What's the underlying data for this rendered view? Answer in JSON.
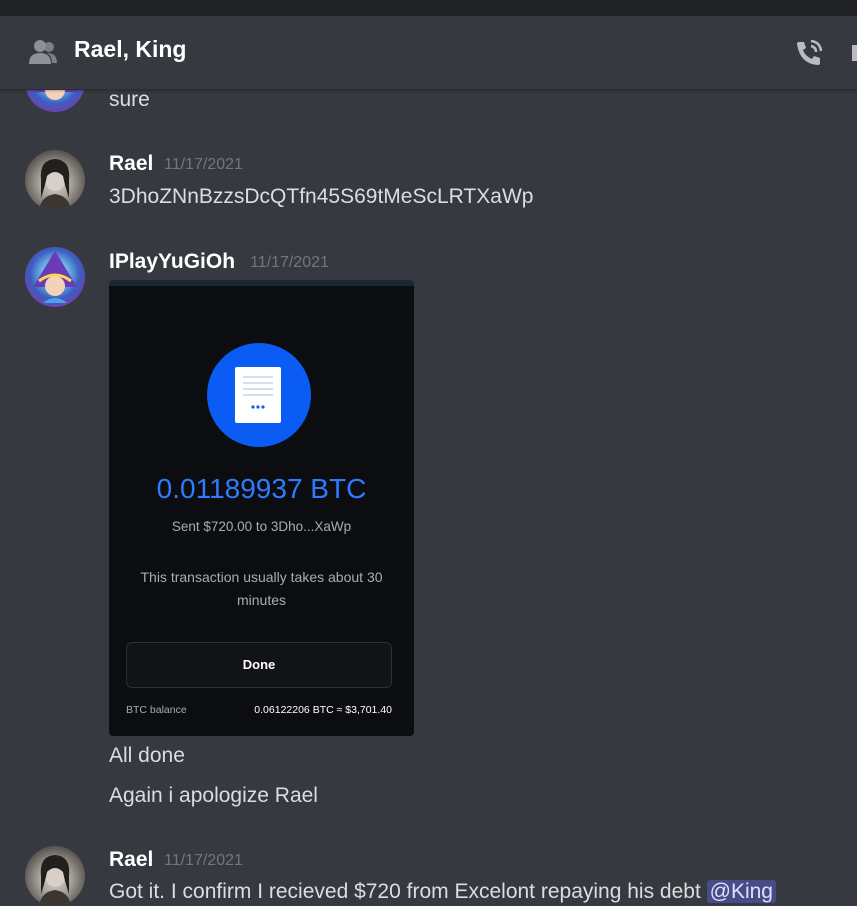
{
  "header": {
    "title": "Rael, King",
    "group_icon": "group-dm-icon",
    "call_icon": "start-voice-call-icon"
  },
  "messages": [
    {
      "text": "sure"
    },
    {
      "author": "Rael",
      "time": "11/17/2021",
      "text": "3DhoZNnBzzsDcQTfn45S69tMeScLRTXaWp"
    },
    {
      "author": "IPlayYuGiOh",
      "time": "11/17/2021",
      "attachment": {
        "amount": "0.01189937 BTC",
        "sent": "Sent $720.00 to 3Dho...XaWp",
        "note": "This transaction usually takes about 30 minutes",
        "done_label": "Done",
        "balance_label": "BTC balance",
        "balance_value": "0.06122206 BTC ≈ $3,701.40",
        "icon": "document-icon",
        "accent": "#0a5cf5"
      },
      "lines": [
        "All done",
        "Again i apologize Rael"
      ]
    },
    {
      "author": "Rael",
      "time": "11/17/2021",
      "text": "Got it. I confirm I recieved $720 from Excelont repaying his debt ",
      "mention": "@King"
    }
  ],
  "colors": {
    "background": "#36393f",
    "mention_bg": "#474c87",
    "timestamp": "#72767d"
  }
}
